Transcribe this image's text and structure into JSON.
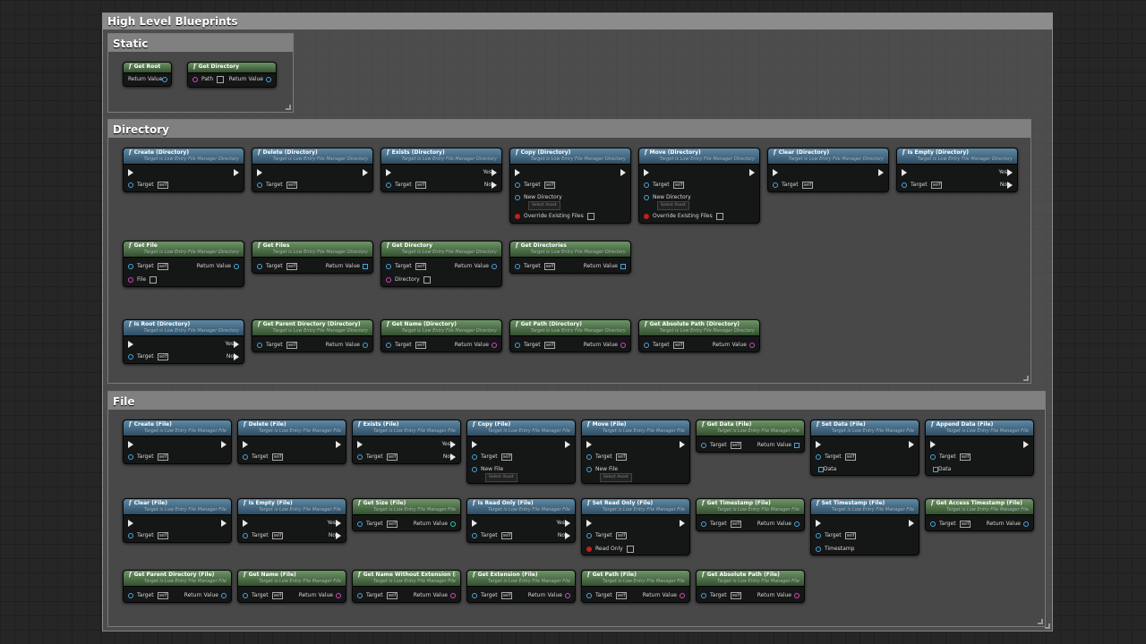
{
  "title": "High Level Blueprints",
  "static_title": "Static",
  "directory_title": "Directory",
  "file_title": "File",
  "dir_sub": "Target is Low Entry File Manager Directory",
  "file_sub": "Target is Low Entry File Manager File",
  "labels": {
    "target": "Target",
    "self": "self",
    "return_value": "Return Value",
    "yes": "Yes",
    "no": "No",
    "path": "Path",
    "file": "File",
    "directory": "Directory",
    "new_directory": "New Directory",
    "new_file": "New File",
    "select_asset": "Select Asset",
    "override": "Override Existing Files",
    "data": "Data",
    "read_only": "Read Only",
    "timestamp": "Timestamp",
    "f": "f"
  },
  "static_nodes": [
    "Get Root",
    "Get Directory"
  ],
  "dir_nodes": [
    "Create (Directory)",
    "Delete (Directory)",
    "Exists (Directory)",
    "Copy (Directory)",
    "Move (Directory)",
    "Clear (Directory)",
    "Is Empty (Directory)",
    "Get File",
    "Get Files",
    "Get Directory",
    "Get Directories",
    "Is Root (Directory)",
    "Get Parent Directory (Directory)",
    "Get Name (Directory)",
    "Get Path (Directory)",
    "Get Absolute Path (Directory)"
  ],
  "file_nodes": [
    "Create (File)",
    "Delete (File)",
    "Exists (File)",
    "Copy (File)",
    "Move (File)",
    "Get Data (File)",
    "Set Data (File)",
    "Append Data (File)",
    "Clear (File)",
    "Is Empty (File)",
    "Get Size (File)",
    "Is Read Only (File)",
    "Set Read Only (File)",
    "Get Timestamp (File)",
    "Set Timestamp (File)",
    "Get Access Timestamp (File)",
    "Get Parent Directory (File)",
    "Get Name (File)",
    "Get Name Without Extension (File)",
    "Get Extension (File)",
    "Get Path (File)",
    "Get Absolute Path (File)"
  ],
  "colors": {
    "pure_header": "#3f6a2f",
    "impure_header": "#2f4d63",
    "object_pin": "#4aa6e0",
    "string_pin": "#e040c8",
    "int_pin": "#30c8b0"
  }
}
